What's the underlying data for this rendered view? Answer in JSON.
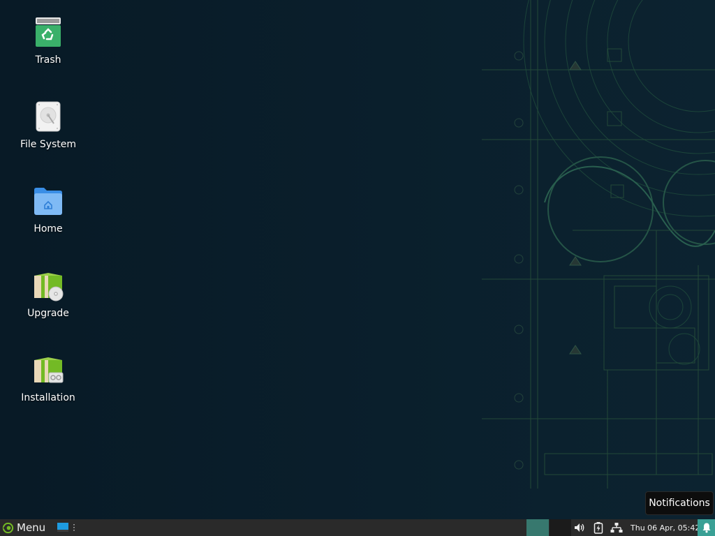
{
  "desktop_icons": [
    {
      "label": "Trash",
      "icon": "trash-icon"
    },
    {
      "label": "File System",
      "icon": "hard-drive-icon"
    },
    {
      "label": "Home",
      "icon": "home-folder-icon"
    },
    {
      "label": "Upgrade",
      "icon": "upgrade-package-icon"
    },
    {
      "label": "Installation",
      "icon": "installation-package-icon"
    }
  ],
  "tooltip": {
    "text": "Notifications"
  },
  "panel": {
    "menu_label": "Menu",
    "clock": "Thu 06 Apr, 05:42",
    "workspaces": [
      "workspace-1",
      "workspace-2"
    ],
    "tray_icons": [
      "volume-icon",
      "battery-icon",
      "network-icon"
    ],
    "notification_icon": "bell-icon"
  },
  "colors": {
    "accent": "#3aa095",
    "active_workspace": "#37786e",
    "panel_bg": "#2a2a2a",
    "desktop_bg": "#0a1f2c",
    "opensuse_green": "#73ba25"
  }
}
